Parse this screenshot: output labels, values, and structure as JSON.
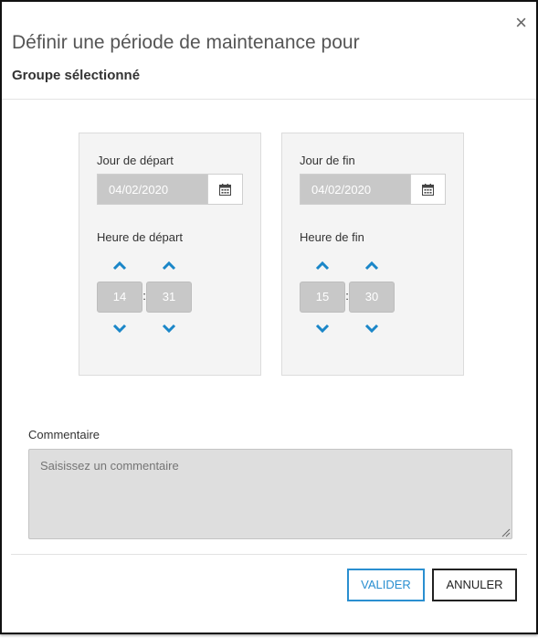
{
  "dialog": {
    "title": "Définir une période de maintenance pour",
    "subtitle": "Groupe sélectionné",
    "close_symbol": "×"
  },
  "start": {
    "day_label": "Jour de départ",
    "date_value": "04/02/2020",
    "hour_label": "Heure de départ",
    "hour": "14",
    "minute": "31"
  },
  "end": {
    "day_label": "Jour de fin",
    "date_value": "04/02/2020",
    "hour_label": "Heure de fin",
    "hour": "15",
    "minute": "30"
  },
  "time_separator": ":",
  "comment": {
    "label": "Commentaire",
    "placeholder": "Saisissez un commentaire"
  },
  "buttons": {
    "validate": "VALIDER",
    "cancel": "ANNULER"
  },
  "colors": {
    "accent": "#2a8fd0",
    "arrow": "#1a86c8",
    "field_bg": "#c8c8c8"
  },
  "icons": [
    "close-icon",
    "calendar-icon",
    "chevron-up-icon",
    "chevron-down-icon"
  ]
}
